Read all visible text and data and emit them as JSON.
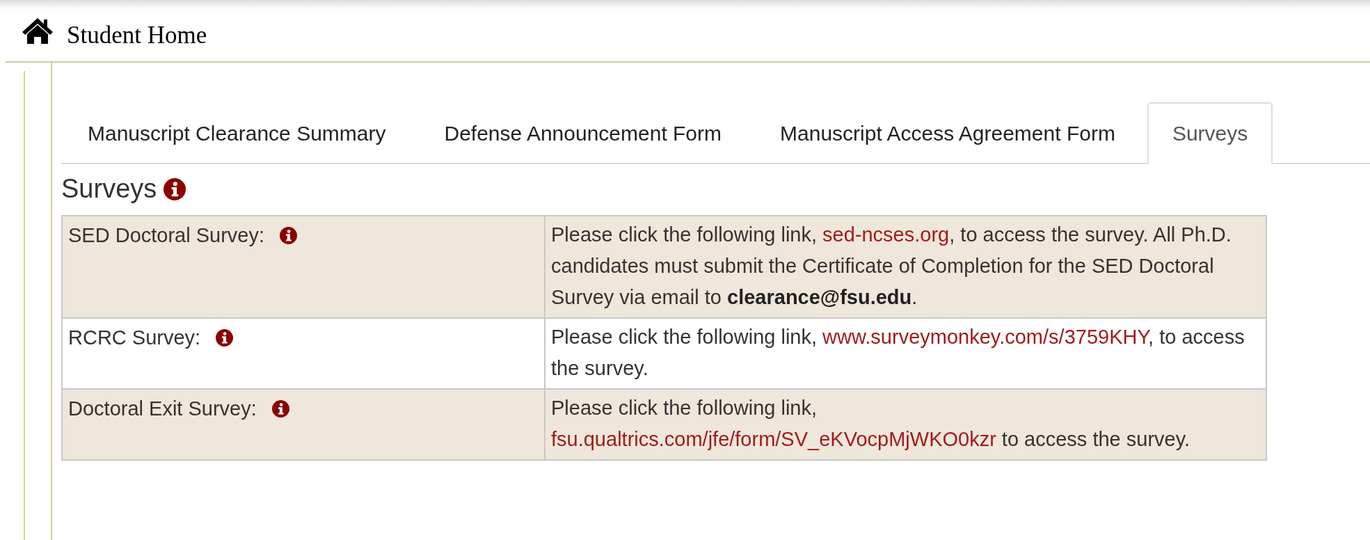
{
  "header": {
    "title": "Student Home"
  },
  "tabs": [
    {
      "label": "Manuscript Clearance Summary",
      "selected": false
    },
    {
      "label": "Defense Announcement Form",
      "selected": false
    },
    {
      "label": "Manuscript Access Agreement Form",
      "selected": false
    },
    {
      "label": "Surveys",
      "selected": true
    }
  ],
  "section": {
    "title": "Surveys"
  },
  "table": {
    "rows": [
      {
        "label": "SED Doctoral Survey:",
        "shaded": true,
        "before": "Please click the following link, ",
        "link": "sed-ncses.org",
        "after": ", to access the survey. All Ph.D. candidates must submit the Certificate of Completion for the SED Doctoral Survey via email to **clearance@fsu.edu**."
      },
      {
        "label": "RCRC Survey:",
        "shaded": false,
        "before": "Please click the following link, ",
        "link": "www.surveymonkey.com/s/3759KHY",
        "after": ", to access the survey."
      },
      {
        "label": "Doctoral Exit Survey:",
        "shaded": true,
        "before": "Please click the following link, ",
        "link": "fsu.qualtrics.com/jfe/form/SV_eKVocpMjWKO0kzr",
        "after": " to access the survey."
      }
    ]
  }
}
